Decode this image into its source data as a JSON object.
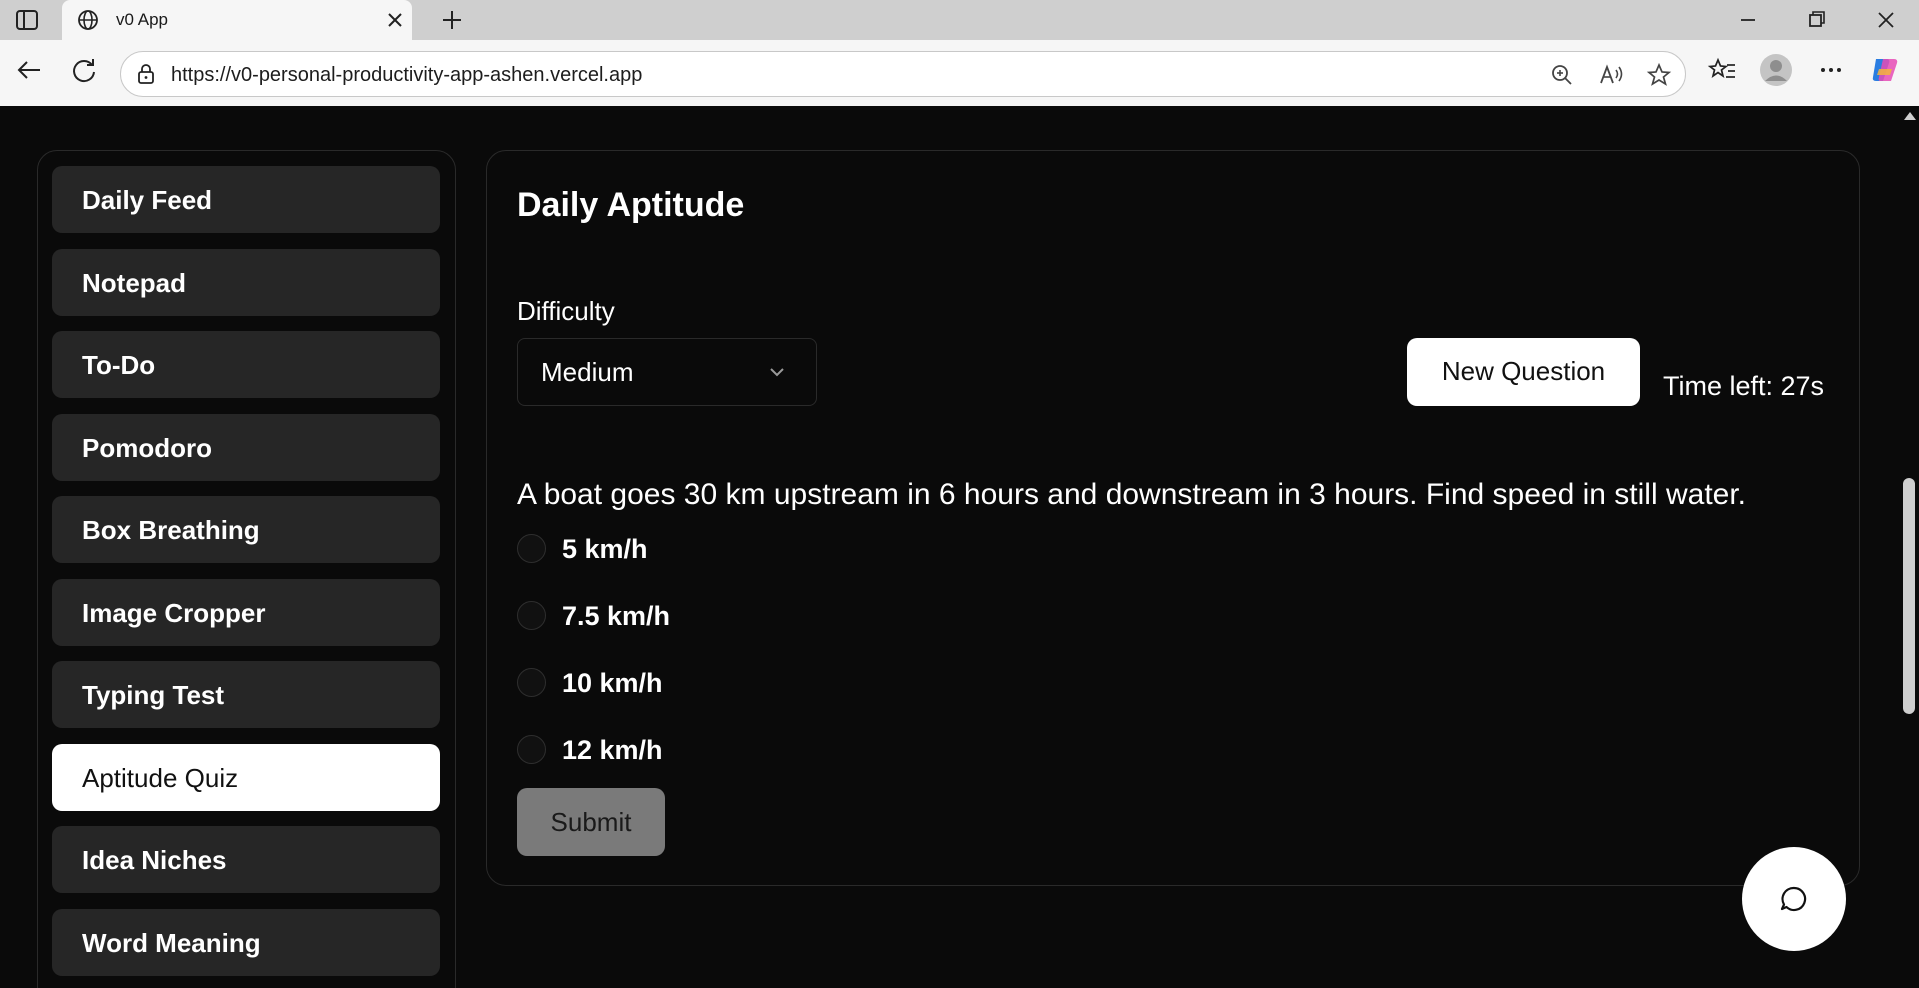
{
  "browser": {
    "tab_title": "v0 App",
    "url": "https://v0-personal-productivity-app-ashen.vercel.app"
  },
  "sidebar": {
    "items": [
      {
        "label": "Daily Feed",
        "active": false
      },
      {
        "label": "Notepad",
        "active": false
      },
      {
        "label": "To-Do",
        "active": false
      },
      {
        "label": "Pomodoro",
        "active": false
      },
      {
        "label": "Box Breathing",
        "active": false
      },
      {
        "label": "Image Cropper",
        "active": false
      },
      {
        "label": "Typing Test",
        "active": false
      },
      {
        "label": "Aptitude Quiz",
        "active": true
      },
      {
        "label": "Idea Niches",
        "active": false
      },
      {
        "label": "Word Meaning",
        "active": false
      }
    ]
  },
  "quiz": {
    "title": "Daily Aptitude",
    "difficulty_label": "Difficulty",
    "difficulty_value": "Medium",
    "new_question_label": "New Question",
    "timer": "Time left: 27s",
    "question": "A boat goes 30 km upstream in 6 hours and downstream in 3 hours. Find speed in still water.",
    "options": [
      "5 km/h",
      "7.5 km/h",
      "10 km/h",
      "12 km/h"
    ],
    "submit_label": "Submit"
  },
  "colors": {
    "background": "#0a0a0a",
    "nav_item": "#262626",
    "active_item": "#ffffff",
    "submit_disabled": "#7a7a7a"
  },
  "icons": {
    "tab_favicon": "globe-icon",
    "chat_fab": "chat-bubble-icon"
  }
}
